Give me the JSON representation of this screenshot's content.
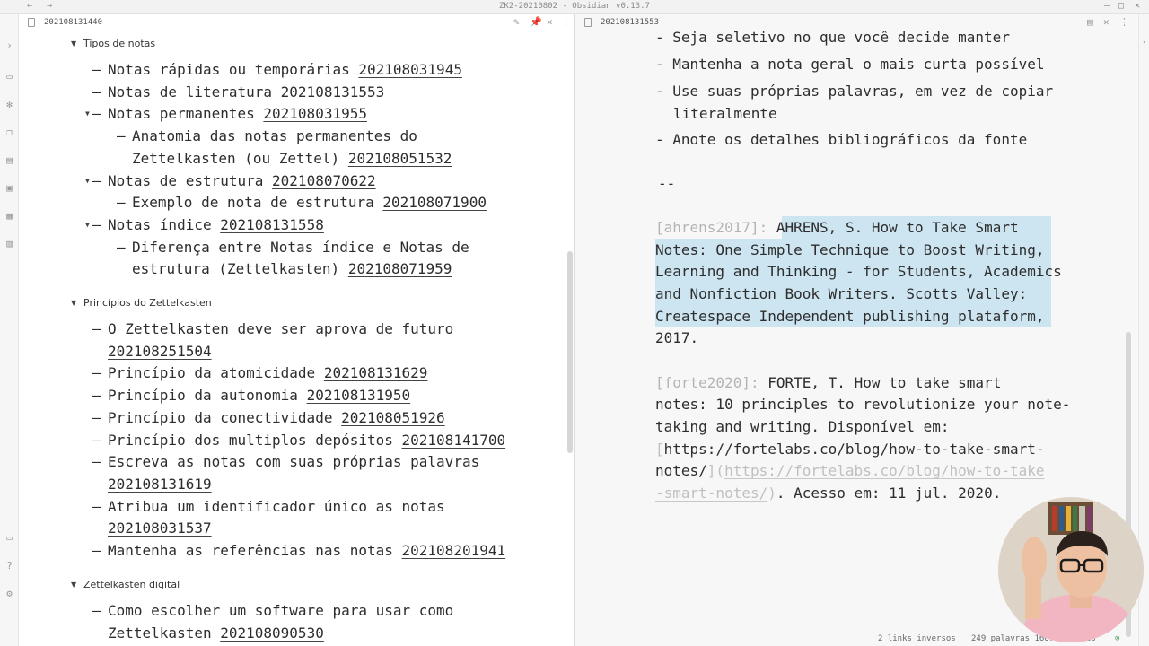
{
  "window": {
    "title": "ZK2-20210802 - Obsidian v0.13.7",
    "back_icon": "arrow-left-icon",
    "forward_icon": "arrow-right-icon"
  },
  "left_pane": {
    "tab_title": "202108131440",
    "sections": [
      {
        "title": "Tipos de notas",
        "items": [
          {
            "lines": [
              {
                "text": "Notas rápidas ou temporárias ",
                "link": "202108031945"
              }
            ]
          },
          {
            "lines": [
              {
                "text": "Notas de literatura ",
                "link": "202108131553"
              }
            ]
          },
          {
            "lines": [
              {
                "text": "Notas permanentes ",
                "link": "202108031955"
              }
            ],
            "collapsible": true
          },
          {
            "lines": [
              {
                "text": "Anatomia das notas permanentes do",
                "link": ""
              },
              {
                "text": "Zettelkasten (ou Zettel) ",
                "link": "202108051532"
              }
            ],
            "nested": true
          },
          {
            "lines": [
              {
                "text": "Notas de estrutura ",
                "link": "202108070622"
              }
            ],
            "collapsible": true
          },
          {
            "lines": [
              {
                "text": "Exemplo de nota de estrutura ",
                "link": "202108071900"
              }
            ],
            "nested": true
          },
          {
            "lines": [
              {
                "text": "Notas índice ",
                "link": "202108131558"
              }
            ],
            "collapsible": true
          },
          {
            "lines": [
              {
                "text": "Diferença entre Notas índice e Notas de",
                "link": ""
              },
              {
                "text": "estrutura (Zettelkasten) ",
                "link": "202108071959"
              }
            ],
            "nested": true
          }
        ]
      },
      {
        "title": "Princípios do Zettelkasten",
        "items": [
          {
            "lines": [
              {
                "text": "O Zettelkasten deve ser aprova de futuro",
                "link": ""
              },
              {
                "text": "",
                "link": "202108251504"
              }
            ]
          },
          {
            "lines": [
              {
                "text": "Princípio da atomicidade ",
                "link": "202108131629"
              }
            ]
          },
          {
            "lines": [
              {
                "text": "Princípio da autonomia ",
                "link": "202108131950"
              }
            ]
          },
          {
            "lines": [
              {
                "text": "Princípio da conectividade ",
                "link": "202108051926"
              }
            ]
          },
          {
            "lines": [
              {
                "text": "Princípio dos multiplos depósitos ",
                "link": "202108141700"
              }
            ]
          },
          {
            "lines": [
              {
                "text": "Escreva as notas com suas próprias palavras",
                "link": ""
              },
              {
                "text": "",
                "link": "202108131619"
              }
            ]
          },
          {
            "lines": [
              {
                "text": "Atribua um identificador único as notas",
                "link": ""
              },
              {
                "text": "",
                "link": "202108031537"
              }
            ]
          },
          {
            "lines": [
              {
                "text": "Mantenha as referências nas notas ",
                "link": "202108201941"
              }
            ]
          }
        ]
      },
      {
        "title": "Zettelkasten digital",
        "items": [
          {
            "lines": [
              {
                "text": "Como escolher um software para usar como",
                "link": ""
              },
              {
                "text": "Zettelkasten ",
                "link": "202108090530"
              }
            ]
          }
        ]
      }
    ]
  },
  "right_pane": {
    "tab_title": "202108131553",
    "bullets": [
      {
        "lines": [
          "Seja seletivo no que você decide manter"
        ]
      },
      {
        "lines": [
          "Mantenha a nota geral o mais curta possível"
        ]
      },
      {
        "lines": [
          "Use suas próprias palavras, em vez de copiar",
          "literalmente"
        ]
      },
      {
        "lines": [
          "Anote os detalhes bibliográficos da fonte"
        ]
      }
    ],
    "separator": "--",
    "ref1": {
      "cite": "[ahrens2017]:",
      "lines": [
        "AHRENS, S. How to Take Smart",
        "Notes: One Simple Technique to Boost Writing,",
        "Learning and Thinking - for Students, Academics",
        "and Nonfiction Book Writers. Scotts Valley:",
        "Createspace Independent publishing plataform,",
        "2017."
      ]
    },
    "ref2": {
      "cite": "[forte2020]:",
      "line1": "FORTE, T. How to take smart",
      "line2": "notes: 10 principles to revolutionize your note-",
      "line3": "taking and writing. Disponível em:",
      "bracket_open": "[",
      "link_text_1": "https://fortelabs.co/blog/how-to-take-smart-",
      "link_text_2": "notes/",
      "bracket_close": "](",
      "url_1": "https://fortelabs.co/blog/how-to-take",
      "url_2": "-smart-notes/",
      "paren_close": ")",
      "suffix": ". Acesso em: 11 jul. 2020."
    }
  },
  "status": {
    "backlinks": "2 links inversos",
    "words": "249 palavras 1667",
    "chars": "es"
  }
}
